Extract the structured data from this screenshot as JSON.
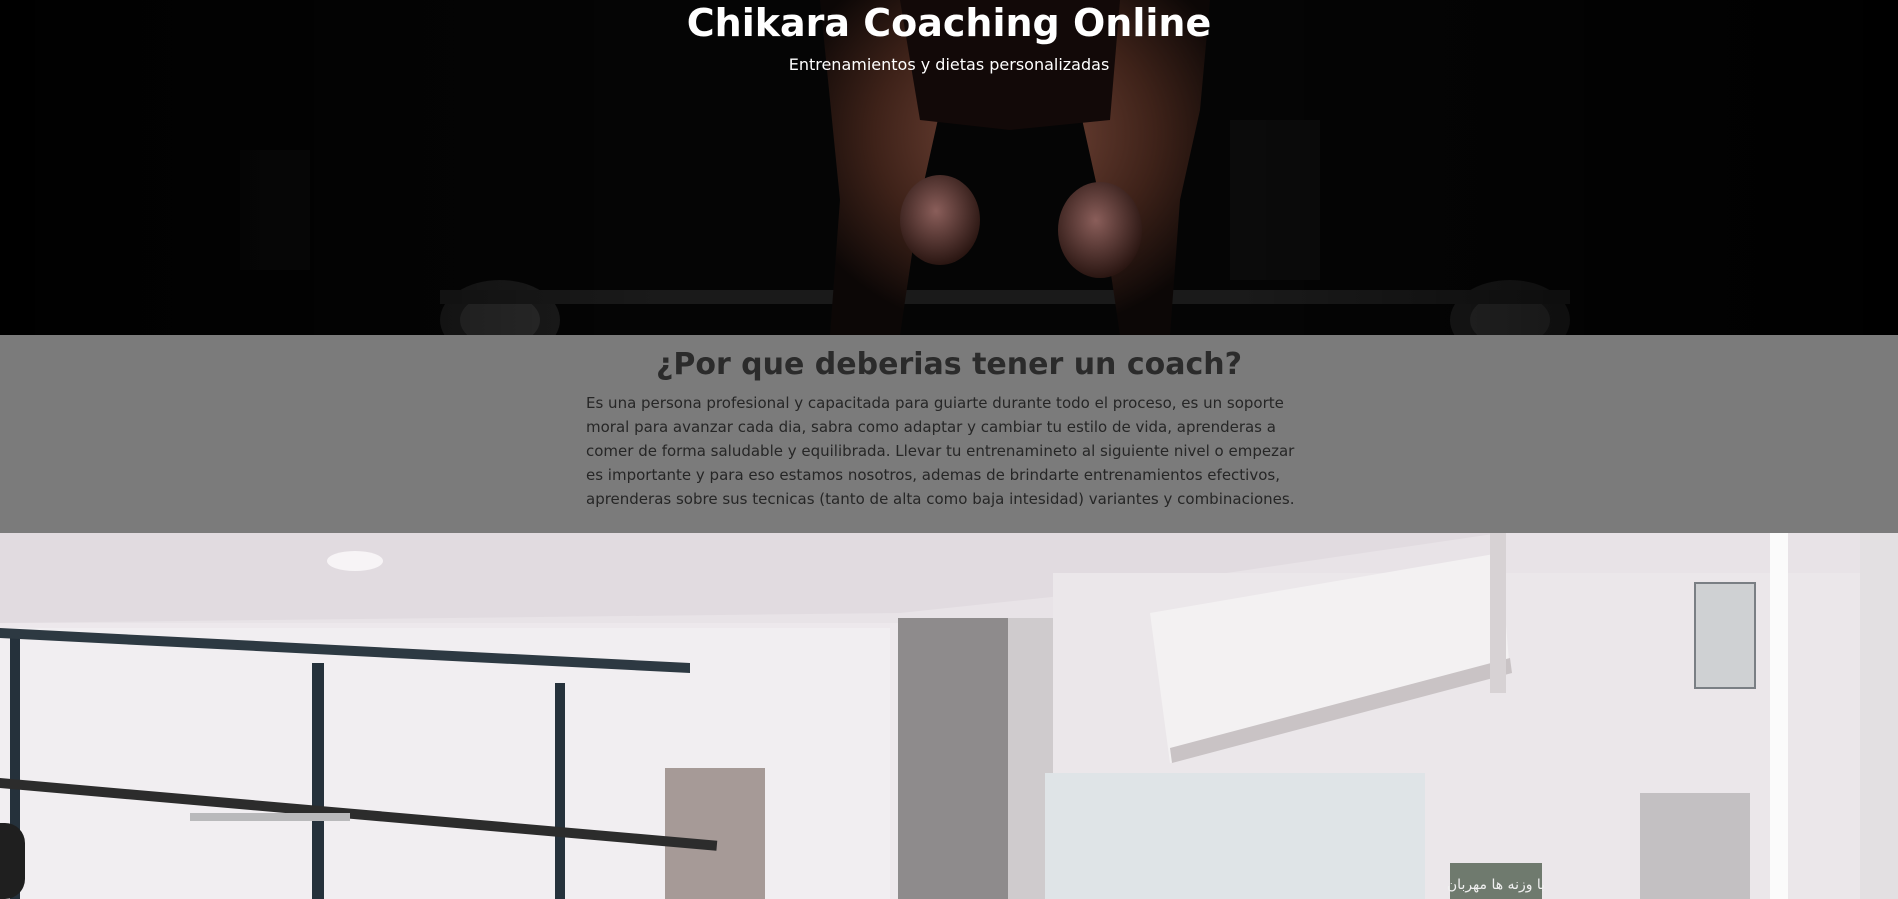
{
  "hero": {
    "title": "Chikara Coaching Online",
    "subtitle": "Entrenamientos y dietas personalizadas",
    "image_subject": "athlete-deadlift-photo"
  },
  "coach_section": {
    "heading": "¿Por que deberias tener un coach?",
    "body": "Es una persona profesional y capacitada para guiarte durante todo el proceso, es un soporte moral para avanzar cada dia, sabra como adaptar y cambiar tu estilo de vida, aprenderas a comer de forma saludable y equilibrada. Llevar tu entrenamineto al siguiente nivel o empezar es importante y para eso estamos nosotros, ademas de brindarte entrenamientos efectivos, aprenderas sobre sus tecnicas (tanto de alta como baja intesidad) variantes y combinaciones."
  },
  "gym_section": {
    "image_subject": "gym-interior-photo",
    "wall_sign": "با وزنه ها مهربان"
  },
  "colors": {
    "hero_bg": "#040404",
    "coach_bg": "#7b7b7b",
    "gym_bg": "#ede8ec",
    "title_text": "#ffffff",
    "heading_text": "#2b2b2b"
  }
}
